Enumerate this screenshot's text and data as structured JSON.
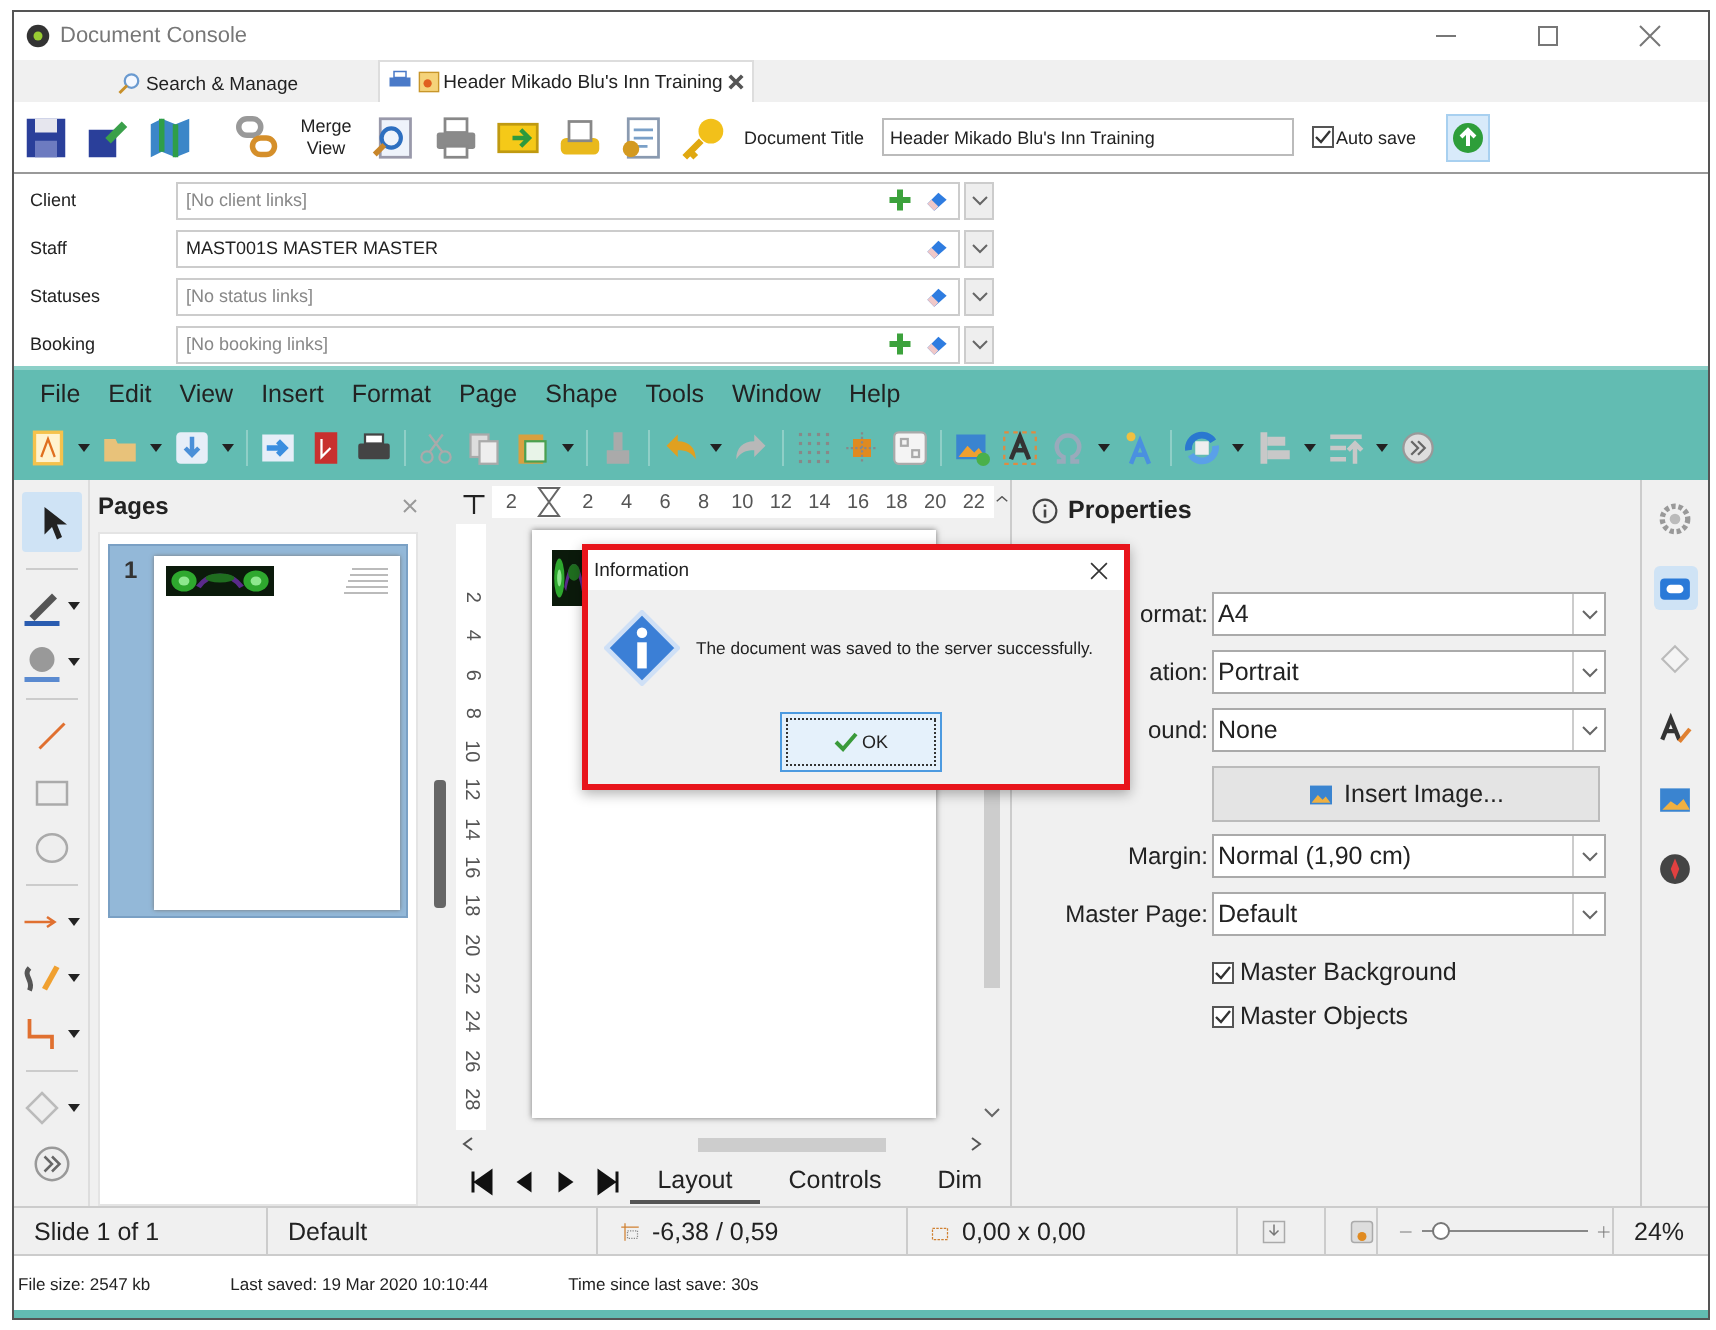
{
  "window": {
    "title": "Document Console"
  },
  "tabs": [
    {
      "label": "Search & Manage",
      "selected": false
    },
    {
      "label": "Header Mikado Blu's Inn Training",
      "selected": true
    }
  ],
  "toolbar": {
    "merge_label": "Merge View",
    "title_label": "Document Title",
    "title_value": "Header Mikado Blu's Inn Training",
    "auto_save": {
      "label": "Auto save",
      "checked": true
    }
  },
  "links": [
    {
      "label": "Client",
      "placeholder": "[No client links]",
      "can_add": true
    },
    {
      "label": "Staff",
      "value": "MAST001S MASTER MASTER",
      "can_add": false
    },
    {
      "label": "Statuses",
      "placeholder": "[No status links]",
      "can_add": false
    },
    {
      "label": "Booking",
      "placeholder": "[No booking links]",
      "can_add": true
    }
  ],
  "menu": [
    "File",
    "Edit",
    "View",
    "Insert",
    "Format",
    "Page",
    "Shape",
    "Tools",
    "Window",
    "Help"
  ],
  "pages_panel": {
    "title": "Pages",
    "pages": [
      {
        "number": "1",
        "selected": true
      }
    ]
  },
  "ruler": {
    "horizontal": [
      "2",
      "2",
      "4",
      "6",
      "8",
      "10",
      "12",
      "14",
      "16",
      "18",
      "20",
      "22"
    ],
    "vertical": [
      "2",
      "4",
      "6",
      "8",
      "10",
      "12",
      "14",
      "16",
      "18",
      "20",
      "22",
      "24",
      "26",
      "28"
    ]
  },
  "view_tabs": [
    {
      "label": "Layout",
      "selected": true
    },
    {
      "label": "Controls",
      "selected": false
    },
    {
      "label": "Dim",
      "selected": false
    }
  ],
  "properties": {
    "title": "Properties",
    "page_fields": [
      {
        "label": "ormat:",
        "value": "A4"
      },
      {
        "label": "ation:",
        "value": "Portrait"
      },
      {
        "label": "ound:",
        "value": "None"
      }
    ],
    "insert_image": "Insert Image...",
    "layout_fields": [
      {
        "label": "Margin:",
        "value": "Normal (1,90 cm)"
      },
      {
        "label": "Master Page:",
        "value": "Default"
      }
    ],
    "options": [
      {
        "label": "Master Background",
        "checked": true
      },
      {
        "label": "Master Objects",
        "checked": true
      }
    ]
  },
  "status_bar": {
    "slide": "Slide 1 of 1",
    "master": "Default",
    "position": "-6,38 / 0,59",
    "size": "0,00 x 0,00",
    "zoom": {
      "level": 0.11
    },
    "zoom_reading": "24%"
  },
  "footer": [
    "File size: 2547 kb",
    "Last saved: 19 Mar 2020 10:10:44",
    "Time since last save: 30s"
  ],
  "dialog": {
    "title": "Information",
    "message": "The document was saved to the server successfully.",
    "button": "OK"
  }
}
